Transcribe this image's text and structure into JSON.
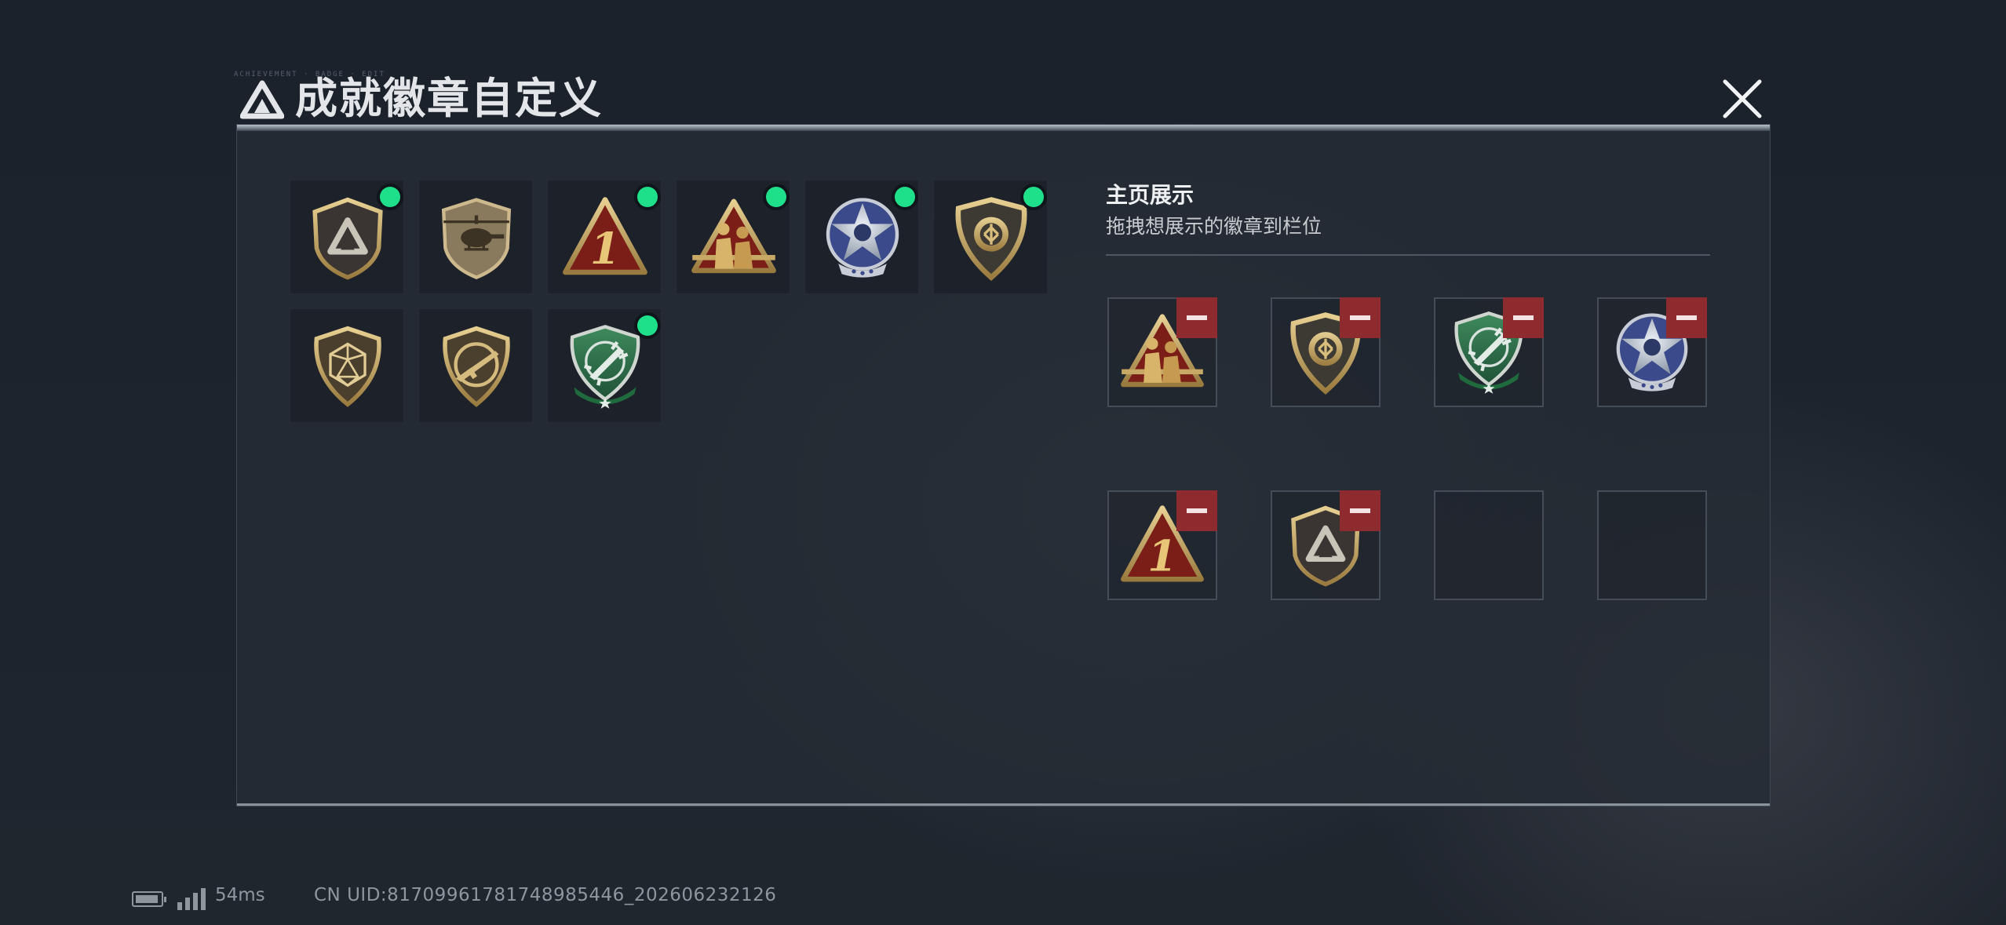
{
  "window": {
    "title": "成就徽章自定义",
    "header_tick": "ACHIEVEMENT · BADGE · EDIT"
  },
  "icons": {
    "title_logo": "triangle-logo-icon",
    "close": "close-icon",
    "remove": "minus-icon"
  },
  "colors": {
    "new_dot": "#1fe08a",
    "remove_button": "#8e2b2f",
    "gold": "#c8a865",
    "panel": "#262c35"
  },
  "collection": {
    "badges": [
      {
        "id": "triangle-shield",
        "new": true
      },
      {
        "id": "helicopter-shield",
        "new": false
      },
      {
        "id": "number-one-triangle",
        "new": true
      },
      {
        "id": "soldiers-triangle",
        "new": true
      },
      {
        "id": "skull-star-medal",
        "new": true
      },
      {
        "id": "gold-target-shield",
        "new": true
      },
      {
        "id": "d20-shield",
        "new": false
      },
      {
        "id": "rifle-shield",
        "new": false
      },
      {
        "id": "green-rocket-shield",
        "new": true
      }
    ]
  },
  "display": {
    "title": "主页展示",
    "hint": "拖拽想展示的徽章到栏位",
    "slots": [
      {
        "badge": "soldiers-triangle"
      },
      {
        "badge": "gold-target-shield"
      },
      {
        "badge": "green-rocket-shield"
      },
      {
        "badge": "skull-star-medal"
      },
      {
        "badge": "number-one-triangle"
      },
      {
        "badge": "triangle-shield"
      },
      {
        "badge": ""
      },
      {
        "badge": ""
      }
    ]
  },
  "status": {
    "ping": "54ms",
    "uid": "CN UID:81709961781748985446_202606232126"
  }
}
